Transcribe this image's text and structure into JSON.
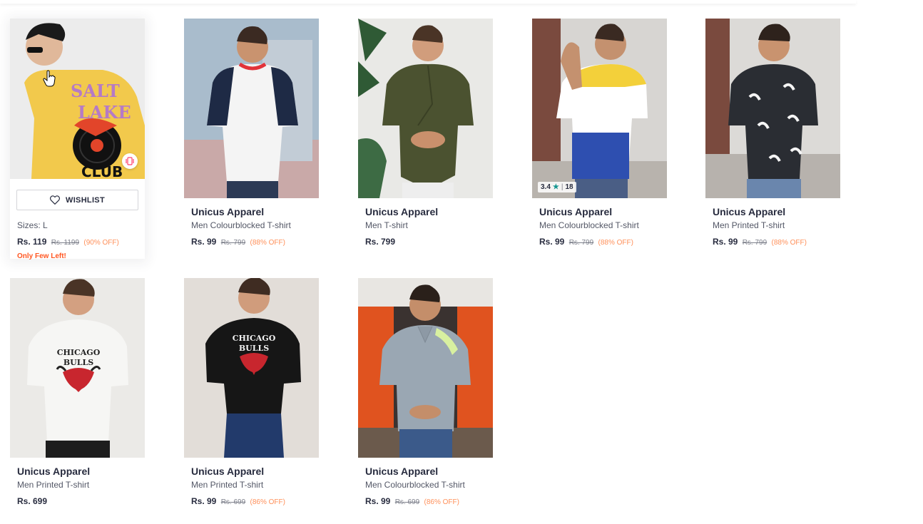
{
  "hovered_card": {
    "wishlist_label": "WISHLIST",
    "sizes": "Sizes: L",
    "price": "Rs. 119",
    "mrp": "Rs. 1199",
    "discount": "(90% OFF)",
    "stock_note": "Only Few Left!"
  },
  "products": [
    {
      "brand": "Unicus Apparel",
      "name": "Men Colourblocked T-shirt",
      "price": "Rs. 99",
      "mrp": "Rs. 799",
      "discount": "(88% OFF)"
    },
    {
      "brand": "Unicus Apparel",
      "name": "Men T-shirt",
      "price": "Rs. 799",
      "mrp": "",
      "discount": ""
    },
    {
      "brand": "Unicus Apparel",
      "name": "Men Colourblocked T-shirt",
      "price": "Rs. 99",
      "mrp": "Rs. 799",
      "discount": "(88% OFF)",
      "rating": "3.4",
      "rating_count": "18"
    },
    {
      "brand": "Unicus Apparel",
      "name": "Men Printed T-shirt",
      "price": "Rs. 99",
      "mrp": "Rs. 799",
      "discount": "(88% OFF)"
    },
    {
      "brand": "Unicus Apparel",
      "name": "Men Printed T-shirt",
      "price": "Rs. 699",
      "mrp": "",
      "discount": ""
    },
    {
      "brand": "Unicus Apparel",
      "name": "Men Printed T-shirt",
      "price": "Rs. 99",
      "mrp": "Rs. 699",
      "discount": "(86% OFF)"
    },
    {
      "brand": "Unicus Apparel",
      "name": "Men Colourblocked T-shirt",
      "price": "Rs. 99",
      "mrp": "Rs. 699",
      "discount": "(86% OFF)"
    }
  ],
  "colors": {
    "accent_discount": "#ff905a",
    "rating_star": "#14958f",
    "stock_warning": "#ff5722"
  },
  "icons": [
    "heart-icon",
    "star-icon",
    "similar-products-icon",
    "hand-cursor-icon"
  ]
}
